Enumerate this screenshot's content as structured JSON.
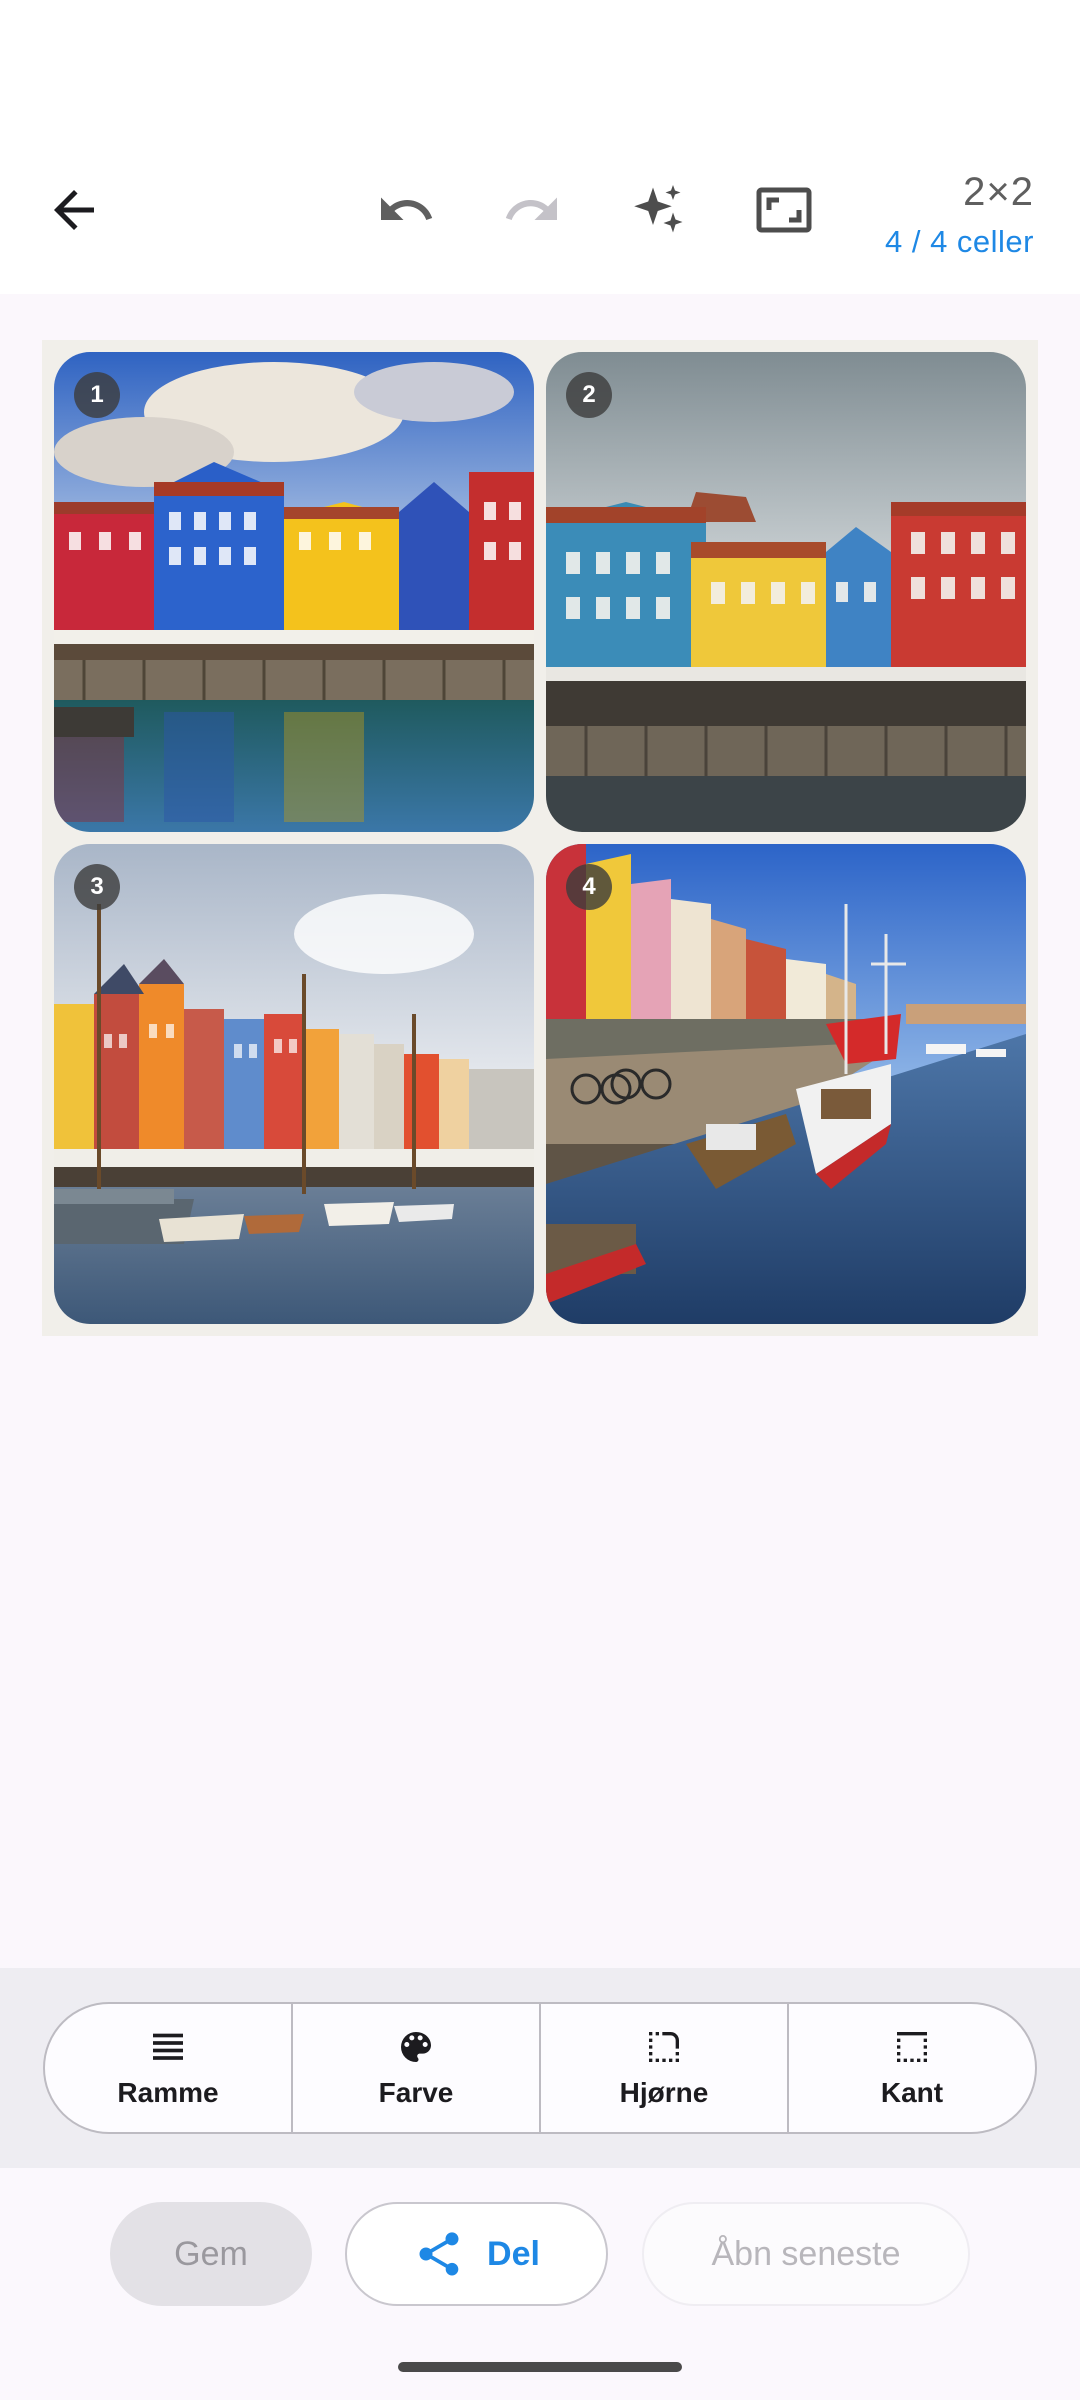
{
  "toolbar": {
    "back_icon": "arrow-back-icon",
    "undo_icon": "undo-icon",
    "redo_icon": "redo-icon",
    "magic_icon": "sparkles-icon",
    "fit_icon": "aspect-ratio-icon",
    "grid_size": "2×2",
    "cell_count": "4 / 4 celler",
    "redo_disabled": true
  },
  "collage": {
    "cells": [
      {
        "number": "1",
        "image": "nyhavn-colorful-houses-sunny"
      },
      {
        "number": "2",
        "image": "nyhavn-houses-overcast"
      },
      {
        "number": "3",
        "image": "nyhavn-canal-sailboats"
      },
      {
        "number": "4",
        "image": "nyhavn-canal-boats-promenade"
      }
    ]
  },
  "tools": [
    {
      "label": "Ramme",
      "icon": "frame-lines-icon"
    },
    {
      "label": "Farve",
      "icon": "palette-icon"
    },
    {
      "label": "Hjørne",
      "icon": "rounded-corner-icon"
    },
    {
      "label": "Kant",
      "icon": "border-edge-icon"
    }
  ],
  "actions": {
    "save_label": "Gem",
    "share_label": "Del",
    "share_icon": "share-icon",
    "open_recent_label": "Åbn seneste"
  },
  "colors": {
    "accent": "#1e88e5",
    "panel_background": "#eeedf2",
    "collage_border": "#f1efea"
  }
}
